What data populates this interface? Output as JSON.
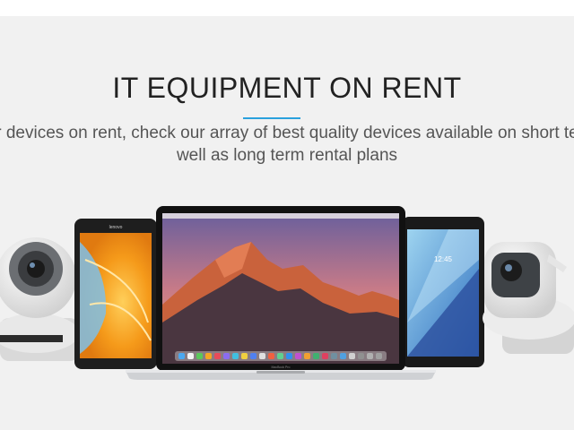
{
  "hero": {
    "title": "IT EQUIPMENT ON RENT",
    "description_line1": "r devices on rent, check our array of best quality devices available on short te",
    "description_line2": "well as long term rental plans"
  },
  "colors": {
    "background": "#f1f1f1",
    "accent": "#2aa1dd",
    "title_text": "#222222",
    "description_text": "#555555"
  },
  "devices": {
    "tablet_left_brand": "lenovo",
    "laptop_brand": "MacBook Pro",
    "tablet_right_time": "12:45"
  }
}
